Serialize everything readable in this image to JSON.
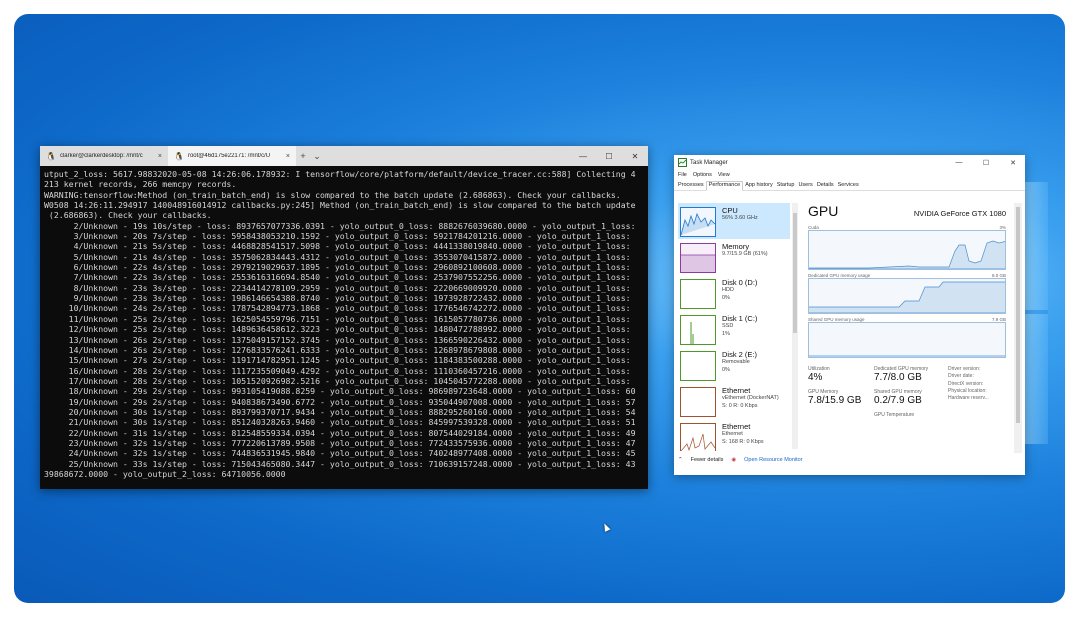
{
  "terminal": {
    "tabs": [
      {
        "label": "clarker@clarkerdesktop: /mnt/c",
        "close": "×"
      },
      {
        "label": "root@46d175e22171: /mnt/c/U",
        "close": "×"
      }
    ],
    "new_tab": "+",
    "dropdown": "⌄",
    "window_controls": {
      "minimize": "—",
      "maximize": "☐",
      "close": "✕"
    },
    "lines": [
      "utput_2_loss: 5617.98832020-05-08 14:26:06.178932: I tensorflow/core/platform/default/device_tracer.cc:588] Collecting 4",
      "213 kernel records, 266 memcpy records.",
      "WARNING:tensorflow:Method (on_train_batch_end) is slow compared to the batch update (2.686863). Check your callbacks.",
      "W0508 14:26:11.294917 140048916014912 callbacks.py:245] Method (on_train_batch_end) is slow compared to the batch update",
      " (2.686863). Check your callbacks.",
      "      2/Unknown - 19s 10s/step - loss: 8937657077336.0391 - yolo_output_0_loss: 8882676039680.0000 - yolo_output_1_loss:",
      "      3/Unknown - 20s 7s/step - loss: 5958438053210.1592 - yolo_output_0_loss: 5921784201216.0000 - yolo_output_1_loss:",
      "      4/Unknown - 21s 5s/step - loss: 4468828541517.5098 - yolo_output_0_loss: 4441338019840.0000 - yolo_output_1_loss:",
      "      5/Unknown - 21s 4s/step - loss: 3575062834443.4312 - yolo_output_0_loss: 3553070415872.0000 - yolo_output_1_loss:",
      "      6/Unknown - 22s 4s/step - loss: 2979219029637.1895 - yolo_output_0_loss: 2960892100608.0000 - yolo_output_1_loss:",
      "      7/Unknown - 22s 3s/step - loss: 2553616316694.8540 - yolo_output_0_loss: 2537907552256.0000 - yolo_output_1_loss:",
      "      8/Unknown - 23s 3s/step - loss: 2234414278109.2959 - yolo_output_0_loss: 2220669009920.0000 - yolo_output_1_loss:",
      "      9/Unknown - 23s 3s/step - loss: 1986146654388.8740 - yolo_output_0_loss: 1973928722432.0000 - yolo_output_1_loss:",
      "     10/Unknown - 24s 2s/step - loss: 1787542894773.1868 - yolo_output_0_loss: 1776546742272.0000 - yolo_output_1_loss:",
      "     11/Unknown - 25s 2s/step - loss: 1625054559796.7151 - yolo_output_0_loss: 1615057780736.0000 - yolo_output_1_loss:",
      "     12/Unknown - 25s 2s/step - loss: 1489636458612.3223 - yolo_output_0_loss: 1480472788992.0000 - yolo_output_1_loss:",
      "     13/Unknown - 26s 2s/step - loss: 1375049157152.3745 - yolo_output_0_loss: 1366590226432.0000 - yolo_output_1_loss:",
      "     14/Unknown - 26s 2s/step - loss: 1276833576241.6333 - yolo_output_0_loss: 1268978679808.0000 - yolo_output_1_loss:",
      "     15/Unknown - 27s 2s/step - loss: 1191714782951.1245 - yolo_output_0_loss: 1184383500288.0000 - yolo_output_1_loss:",
      "     16/Unknown - 28s 2s/step - loss: 1117235509049.4292 - yolo_output_0_loss: 1110360457216.0000 - yolo_output_1_loss:",
      "     17/Unknown - 28s 2s/step - loss: 1051520926982.5216 - yolo_output_0_loss: 1045045772288.0000 - yolo_output_1_loss:",
      "     18/Unknown - 29s 2s/step - loss: 993105419088.8259 - yolo_output_0_loss: 986989723648.0000 - yolo_output_1_loss: 60",
      "     19/Unknown - 29s 2s/step - loss: 940838673490.6772 - yolo_output_0_loss: 935044907008.0000 - yolo_output_1_loss: 57",
      "     20/Unknown - 30s 1s/step - loss: 893799370717.9434 - yolo_output_0_loss: 888295260160.0000 - yolo_output_1_loss: 54",
      "     21/Unknown - 30s 1s/step - loss: 851240328263.9460 - yolo_output_0_loss: 845997539328.0000 - yolo_output_1_loss: 51",
      "     22/Unknown - 31s 1s/step - loss: 812548559334.0394 - yolo_output_0_loss: 807544029184.0000 - yolo_output_1_loss: 49",
      "     23/Unknown - 32s 1s/step - loss: 777220613789.9508 - yolo_output_0_loss: 772433575936.0000 - yolo_output_1_loss: 47",
      "     24/Unknown - 32s 1s/step - loss: 744836531945.9840 - yolo_output_0_loss: 740248977408.0000 - yolo_output_1_loss: 45",
      "     25/Unknown - 33s 1s/step - loss: 715043465080.3447 - yolo_output_0_loss: 710639157248.0000 - yolo_output_1_loss: 43",
      "39868672.0000 - yolo_output_2_loss: 64710056.0000"
    ]
  },
  "task_manager": {
    "title": "Task Manager",
    "window_controls": {
      "minimize": "—",
      "maximize": "☐",
      "close": "✕"
    },
    "menu": [
      "File",
      "Options",
      "View"
    ],
    "tabs": [
      "Processes",
      "Performance",
      "App history",
      "Startup",
      "Users",
      "Details",
      "Services"
    ],
    "active_tab": "Performance",
    "resources": [
      {
        "name": "CPU",
        "d1": "56% 3.60 GHz",
        "d2": "",
        "d3": ""
      },
      {
        "name": "Memory",
        "d1": "9.7/15.9 GB (61%)",
        "d2": "",
        "d3": ""
      },
      {
        "name": "Disk 0 (D:)",
        "d1": "HDD",
        "d2": "0%",
        "d3": ""
      },
      {
        "name": "Disk 1 (C:)",
        "d1": "SSD",
        "d2": "1%",
        "d3": ""
      },
      {
        "name": "Disk 2 (E:)",
        "d1": "Removable",
        "d2": "0%",
        "d3": ""
      },
      {
        "name": "Ethernet",
        "d1": "vEthernet (DockerNAT)",
        "d2": "S: 0 R: 0 Kbps",
        "d3": ""
      },
      {
        "name": "Ethernet",
        "d1": "Ethernet",
        "d2": "S: 168 R: 0 Kbps",
        "d3": ""
      }
    ],
    "gpu": {
      "title": "GPU",
      "model": "NVIDIA GeForce GTX 1080",
      "graph1_label": "Cuda",
      "graph1_right": "3%",
      "graph2_label": "Dedicated GPU memory usage",
      "graph2_right": "8.0 GB",
      "graph3_label": "Shared GPU memory usage",
      "graph3_right": "7.9 GB",
      "utilization_label": "Utilization",
      "utilization": "4%",
      "dedicated_label": "Dedicated GPU memory",
      "dedicated": "7.7/8.0 GB",
      "gpu_memory_label": "GPU Memory",
      "gpu_memory": "7.8/15.9 GB",
      "shared_label": "Shared GPU memory",
      "shared": "0.2/7.9 GB",
      "temp_label": "GPU Temperature",
      "side": [
        "Driver version:",
        "Driver date:",
        "DirectX version:",
        "Physical location:",
        "Hardware reserv..."
      ]
    },
    "footer": {
      "fewer": "Fewer details",
      "monitor": "Open Resource Monitor"
    }
  }
}
